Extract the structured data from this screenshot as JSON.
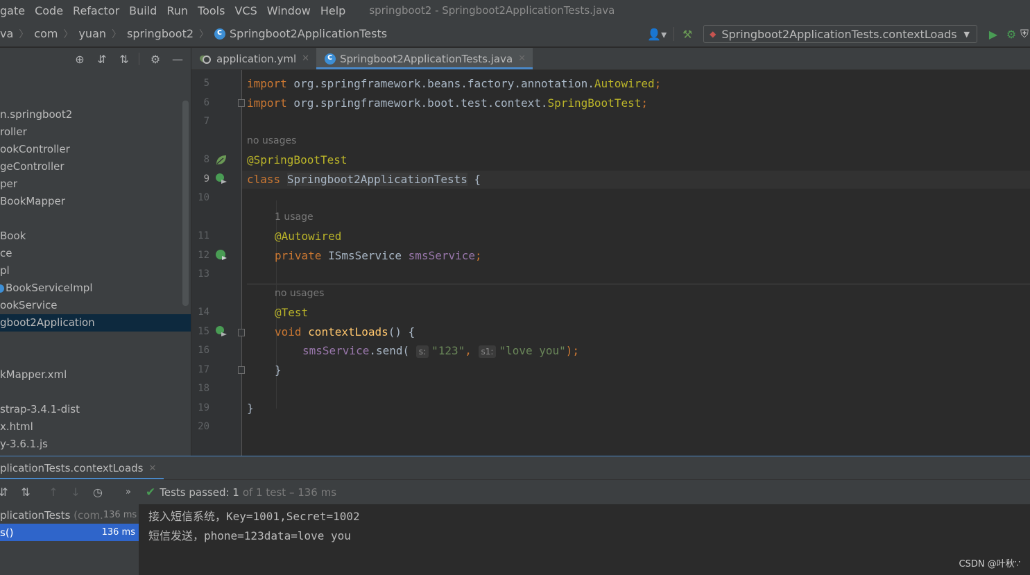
{
  "menu": {
    "items": [
      "gate",
      "Code",
      "Refactor",
      "Build",
      "Run",
      "Tools",
      "VCS",
      "Window",
      "Help"
    ],
    "window_title": "springboot2 - Springboot2ApplicationTests.java"
  },
  "breadcrumb": {
    "items": [
      "va",
      "com",
      "yuan",
      "springboot2",
      "Springboot2ApplicationTests"
    ]
  },
  "toolbar": {
    "run_config": "Springboot2ApplicationTests.contextLoads",
    "icons": [
      "user-icon",
      "build-hammer-icon",
      "run-icon",
      "debug-icon",
      "coverage-icon"
    ]
  },
  "project_tree": {
    "rows": [
      {
        "label": "n.springboot2"
      },
      {
        "label": "roller"
      },
      {
        "label": "ookController"
      },
      {
        "label": "geController"
      },
      {
        "label": "per"
      },
      {
        "label": "BookMapper"
      },
      {
        "label": ""
      },
      {
        "label": "Book"
      },
      {
        "label": "ce"
      },
      {
        "label": "pl"
      },
      {
        "label": "BookServiceImpl"
      },
      {
        "label": "ookService"
      },
      {
        "label": "gboot2Application"
      },
      {
        "label": ""
      },
      {
        "label": ""
      },
      {
        "label": "kMapper.xml"
      },
      {
        "label": ""
      },
      {
        "label": "strap-3.4.1-dist"
      },
      {
        "label": "x.html"
      },
      {
        "label": "y-3.6.1.js"
      }
    ],
    "selected_index": 12
  },
  "editor_tabs": [
    {
      "label": "application.yml",
      "active": false
    },
    {
      "label": "Springboot2ApplicationTests.java",
      "active": true
    }
  ],
  "editor": {
    "line_numbers": [
      "5",
      "6",
      "7",
      "8",
      "9",
      "10",
      "11",
      "12",
      "13",
      "14",
      "15",
      "16",
      "17",
      "18",
      "19",
      "20"
    ],
    "current_line": "9",
    "hints": {
      "no_usages_1": "no usages",
      "one_usage": "1 usage",
      "no_usages_2": "no usages",
      "param_s": "s:",
      "param_s1": "s1:"
    },
    "code": {
      "import1_kw": "import",
      "import1_pkg": " org.springframework.beans.factory.annotation.",
      "import1_cls": "Autowired",
      "import2_kw": "import",
      "import2_pkg": " org.springframework.boot.test.context.",
      "import2_cls": "SpringBootTest",
      "semicolon": ";",
      "ann_springboottest": "@SpringBootTest",
      "class_kw": "class",
      "class_name": "Springboot2ApplicationTests",
      "brace_open": " {",
      "ann_autowired": "@Autowired",
      "private_kw": "private",
      "field_type": " ISmsService ",
      "field_name": "smsService",
      "ann_test": "@Test",
      "void_kw": "void",
      "method_name": "contextLoads",
      "method_sig": "() {",
      "call_obj": "smsService",
      "call_method": ".send(",
      "arg1": "\"123\"",
      "comma": ",",
      "arg2": "\"love you\"",
      "call_end": ");",
      "close_method": "}",
      "close_class": "}"
    }
  },
  "run_panel": {
    "tab_label": "plicationTests.contextLoads",
    "status_strong": "Tests passed: 1",
    "status_muted": "of 1 test – 136 ms",
    "tree": [
      {
        "label": "plicationTests",
        "muted": "(com.",
        "duration": "136 ms"
      },
      {
        "label": "s()",
        "muted": "",
        "duration": "136 ms"
      }
    ],
    "console": [
      "接入短信系统，Key=1001,Secret=1002",
      "短信发送，phone=123data=love you"
    ]
  },
  "watermark": "CSDN @叶秋∵",
  "colors": {
    "keyword": "#cc7832",
    "annotation": "#bbb529",
    "field": "#9876aa",
    "string": "#6a8759",
    "method": "#ffc66d",
    "selection": "#2f65ca",
    "accent": "#4a88c7",
    "pass_green": "#499c54"
  }
}
